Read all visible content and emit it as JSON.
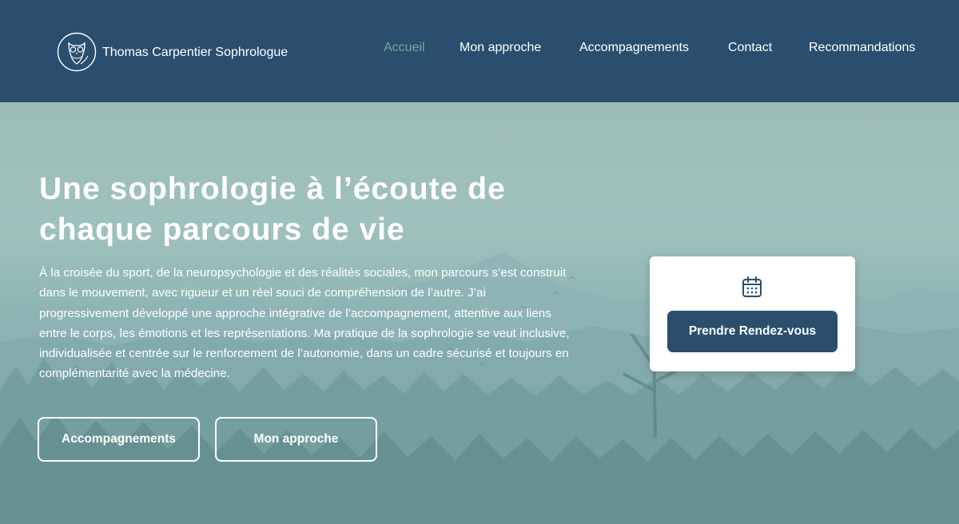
{
  "header": {
    "brand_name": "Thomas Carpentier Sophrologue",
    "logo_icon": "owl-logo-icon",
    "nav": [
      {
        "label": "Accueil",
        "active": true
      },
      {
        "label": "Mon approche",
        "active": false
      },
      {
        "label": "Accompagnements",
        "active": false
      },
      {
        "label": "Contact",
        "active": false
      },
      {
        "label": "Recommandations",
        "active": false
      }
    ]
  },
  "hero": {
    "title_line1": "Une sophrologie à l’écoute de",
    "title_line2": "chaque parcours de vie",
    "description": "À la croisée du sport, de la neuropsychologie et des réalités sociales, mon parcours s’est construit dans le mouvement, avec rigueur et un réel souci de compréhension de l’autre. J’ai progressivement développé une approche intégrative de l’accompagnement, attentive aux liens entre le corps, les émotions et les représentations. Ma pratique de la sophrologie se veut inclusive, individualisée et centrée sur le renforcement de l’autonomie, dans un cadre sécurisé et toujours en complémentarité avec la médecine.",
    "buttons": {
      "accompagnements": "Accompagnements",
      "approche": "Mon approche"
    },
    "background_icon": "mountain-forest-birds-illustration"
  },
  "appointment": {
    "icon": "calendar-icon",
    "button_label": "Prendre Rendez-vous"
  },
  "colors": {
    "header_bg": "#2b4e6e",
    "nav_active": "#6fa9a0",
    "button_primary": "#2b4e6e"
  }
}
